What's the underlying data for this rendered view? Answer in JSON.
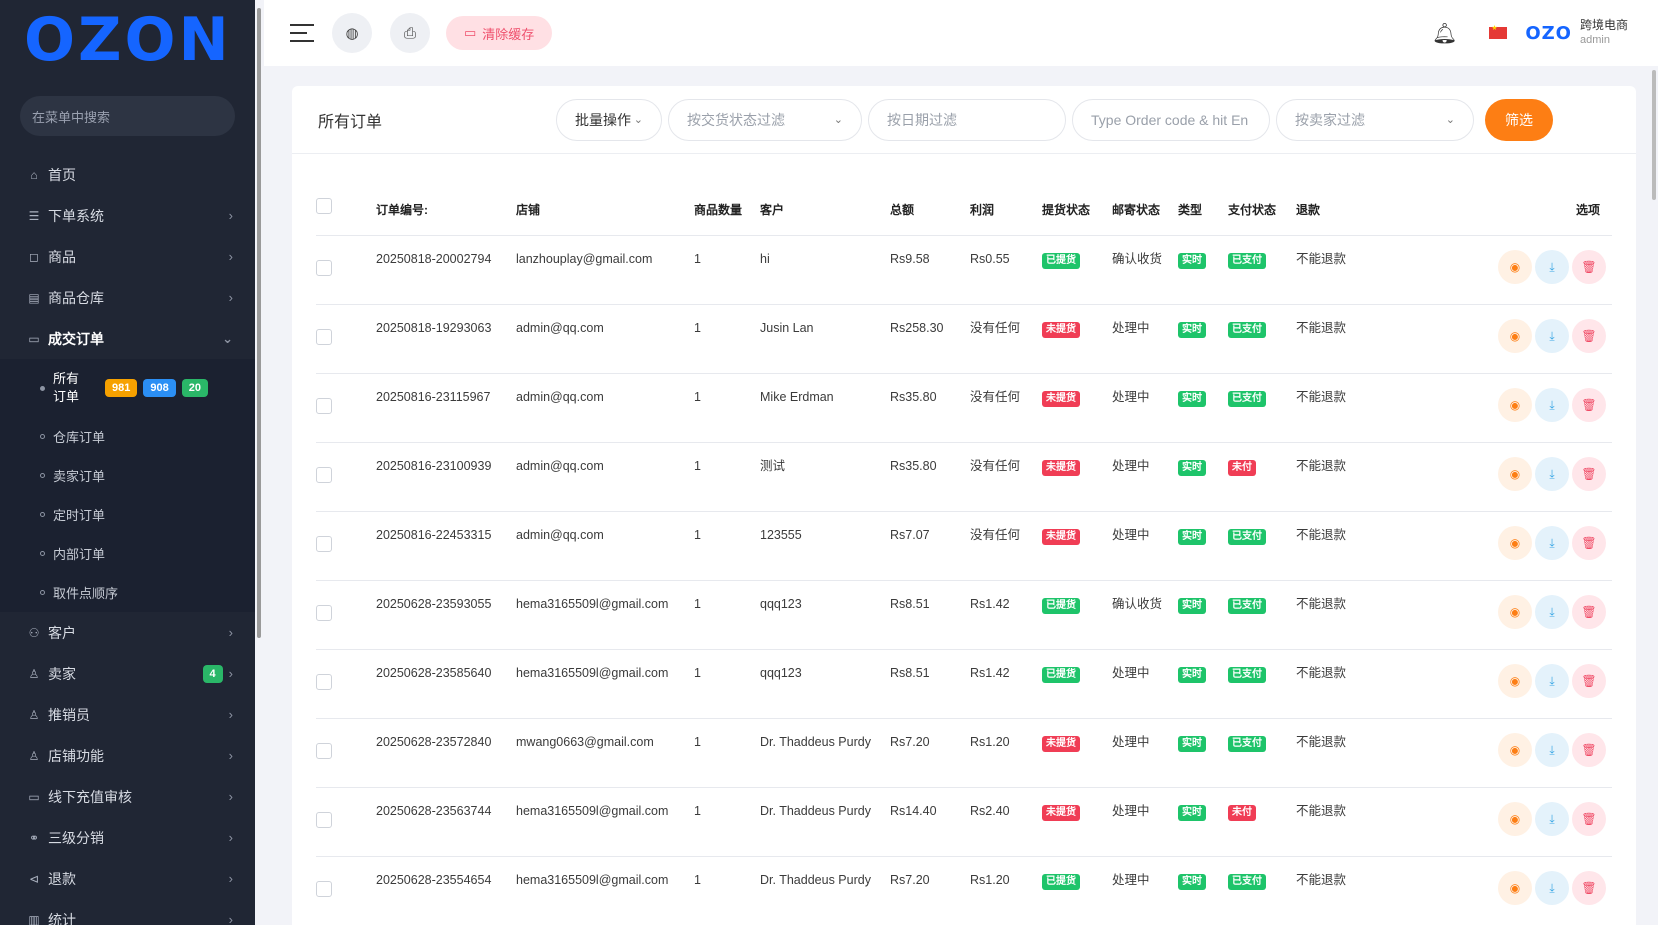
{
  "sidebar": {
    "logo": "OZON",
    "search_placeholder": "在菜单中搜索",
    "items": [
      {
        "label": "首页",
        "icon": "home-icon",
        "arrow": false
      },
      {
        "label": "下单系统",
        "icon": "list-icon",
        "arrow": true
      },
      {
        "label": "商品",
        "icon": "bag-icon",
        "arrow": true
      },
      {
        "label": "商品仓库",
        "icon": "warehouse-icon",
        "arrow": true
      },
      {
        "label": "成交订单",
        "icon": "order-icon",
        "arrow": true,
        "expanded": true
      }
    ],
    "sub_items": [
      {
        "label": "所有订单",
        "active": true,
        "badges": [
          "981",
          "908",
          "20"
        ]
      },
      {
        "label": "仓库订单"
      },
      {
        "label": "卖家订单"
      },
      {
        "label": "定时订单"
      },
      {
        "label": "内部订单"
      },
      {
        "label": "取件点顺序"
      }
    ],
    "items_after": [
      {
        "label": "客户",
        "icon": "users-icon"
      },
      {
        "label": "卖家",
        "icon": "user-icon",
        "badge": "4"
      },
      {
        "label": "推销员",
        "icon": "user-icon"
      },
      {
        "label": "店铺功能",
        "icon": "user-icon"
      },
      {
        "label": "线下充值审核",
        "icon": "card-icon"
      },
      {
        "label": "三级分销",
        "icon": "link-icon"
      },
      {
        "label": "退款",
        "icon": "refund-icon"
      },
      {
        "label": "统计",
        "icon": "stats-icon"
      }
    ]
  },
  "topbar": {
    "clear_cache": "清除缓存",
    "brand": "跨境电商",
    "role": "admin",
    "mini_logo": "OZO"
  },
  "card": {
    "title": "所有订单",
    "bulk_action": "批量操作",
    "delivery_filter": "按交货状态过滤",
    "date_filter": "按日期过滤",
    "code_input": "Type Order code & hit En",
    "seller_filter": "按卖家过滤",
    "filter_btn": "筛选"
  },
  "table": {
    "headers": [
      "订单编号:",
      "店铺",
      "商品数量",
      "客户",
      "总额",
      "利润",
      "提货状态",
      "邮寄状态",
      "类型",
      "支付状态",
      "退款",
      "选项"
    ],
    "rows": [
      {
        "code": "20250818-20002794",
        "shop": "lanzhouplay@gmail.com",
        "qty": "1",
        "customer": "hi",
        "total": "Rs9.58",
        "profit": "Rs0.55",
        "pickup": "已提货",
        "pickup_ok": true,
        "mail": "确认收货",
        "type": "实时",
        "pay": "已支付",
        "pay_ok": true,
        "refund": "不能退款"
      },
      {
        "code": "20250818-19293063",
        "shop": "admin@qq.com",
        "qty": "1",
        "customer": "Jusin Lan",
        "total": "Rs258.30",
        "profit": "没有任何",
        "pickup": "未提货",
        "pickup_ok": false,
        "mail": "处理中",
        "type": "实时",
        "pay": "已支付",
        "pay_ok": true,
        "refund": "不能退款"
      },
      {
        "code": "20250816-23115967",
        "shop": "admin@qq.com",
        "qty": "1",
        "customer": "Mike Erdman",
        "total": "Rs35.80",
        "profit": "没有任何",
        "pickup": "未提货",
        "pickup_ok": false,
        "mail": "处理中",
        "type": "实时",
        "pay": "已支付",
        "pay_ok": true,
        "refund": "不能退款"
      },
      {
        "code": "20250816-23100939",
        "shop": "admin@qq.com",
        "qty": "1",
        "customer": "测试",
        "total": "Rs35.80",
        "profit": "没有任何",
        "pickup": "未提货",
        "pickup_ok": false,
        "mail": "处理中",
        "type": "实时",
        "pay": "未付",
        "pay_ok": false,
        "refund": "不能退款"
      },
      {
        "code": "20250816-22453315",
        "shop": "admin@qq.com",
        "qty": "1",
        "customer": "123555",
        "total": "Rs7.07",
        "profit": "没有任何",
        "pickup": "未提货",
        "pickup_ok": false,
        "mail": "处理中",
        "type": "实时",
        "pay": "已支付",
        "pay_ok": true,
        "refund": "不能退款"
      },
      {
        "code": "20250628-23593055",
        "shop": "hema3165509l@gmail.com",
        "qty": "1",
        "customer": "qqq123",
        "total": "Rs8.51",
        "profit": "Rs1.42",
        "pickup": "已提货",
        "pickup_ok": true,
        "mail": "确认收货",
        "type": "实时",
        "pay": "已支付",
        "pay_ok": true,
        "refund": "不能退款"
      },
      {
        "code": "20250628-23585640",
        "shop": "hema3165509l@gmail.com",
        "qty": "1",
        "customer": "qqq123",
        "total": "Rs8.51",
        "profit": "Rs1.42",
        "pickup": "已提货",
        "pickup_ok": true,
        "mail": "处理中",
        "type": "实时",
        "pay": "已支付",
        "pay_ok": true,
        "refund": "不能退款"
      },
      {
        "code": "20250628-23572840",
        "shop": "mwang0663@gmail.com",
        "qty": "1",
        "customer": "Dr. Thaddeus Purdy",
        "total": "Rs7.20",
        "profit": "Rs1.20",
        "pickup": "未提货",
        "pickup_ok": false,
        "mail": "处理中",
        "type": "实时",
        "pay": "已支付",
        "pay_ok": true,
        "refund": "不能退款"
      },
      {
        "code": "20250628-23563744",
        "shop": "hema3165509l@gmail.com",
        "qty": "1",
        "customer": "Dr. Thaddeus Purdy",
        "total": "Rs14.40",
        "profit": "Rs2.40",
        "pickup": "未提货",
        "pickup_ok": false,
        "mail": "处理中",
        "type": "实时",
        "pay": "未付",
        "pay_ok": false,
        "refund": "不能退款"
      },
      {
        "code": "20250628-23554654",
        "shop": "hema3165509l@gmail.com",
        "qty": "1",
        "customer": "Dr. Thaddeus Purdy",
        "total": "Rs7.20",
        "profit": "Rs1.20",
        "pickup": "已提货",
        "pickup_ok": true,
        "mail": "处理中",
        "type": "实时",
        "pay": "已支付",
        "pay_ok": true,
        "refund": "不能退款"
      }
    ]
  },
  "colors": {
    "brand": "#1565ff",
    "accent": "#fd7e14",
    "ok": "#1ec46a",
    "bad": "#f03d55"
  }
}
